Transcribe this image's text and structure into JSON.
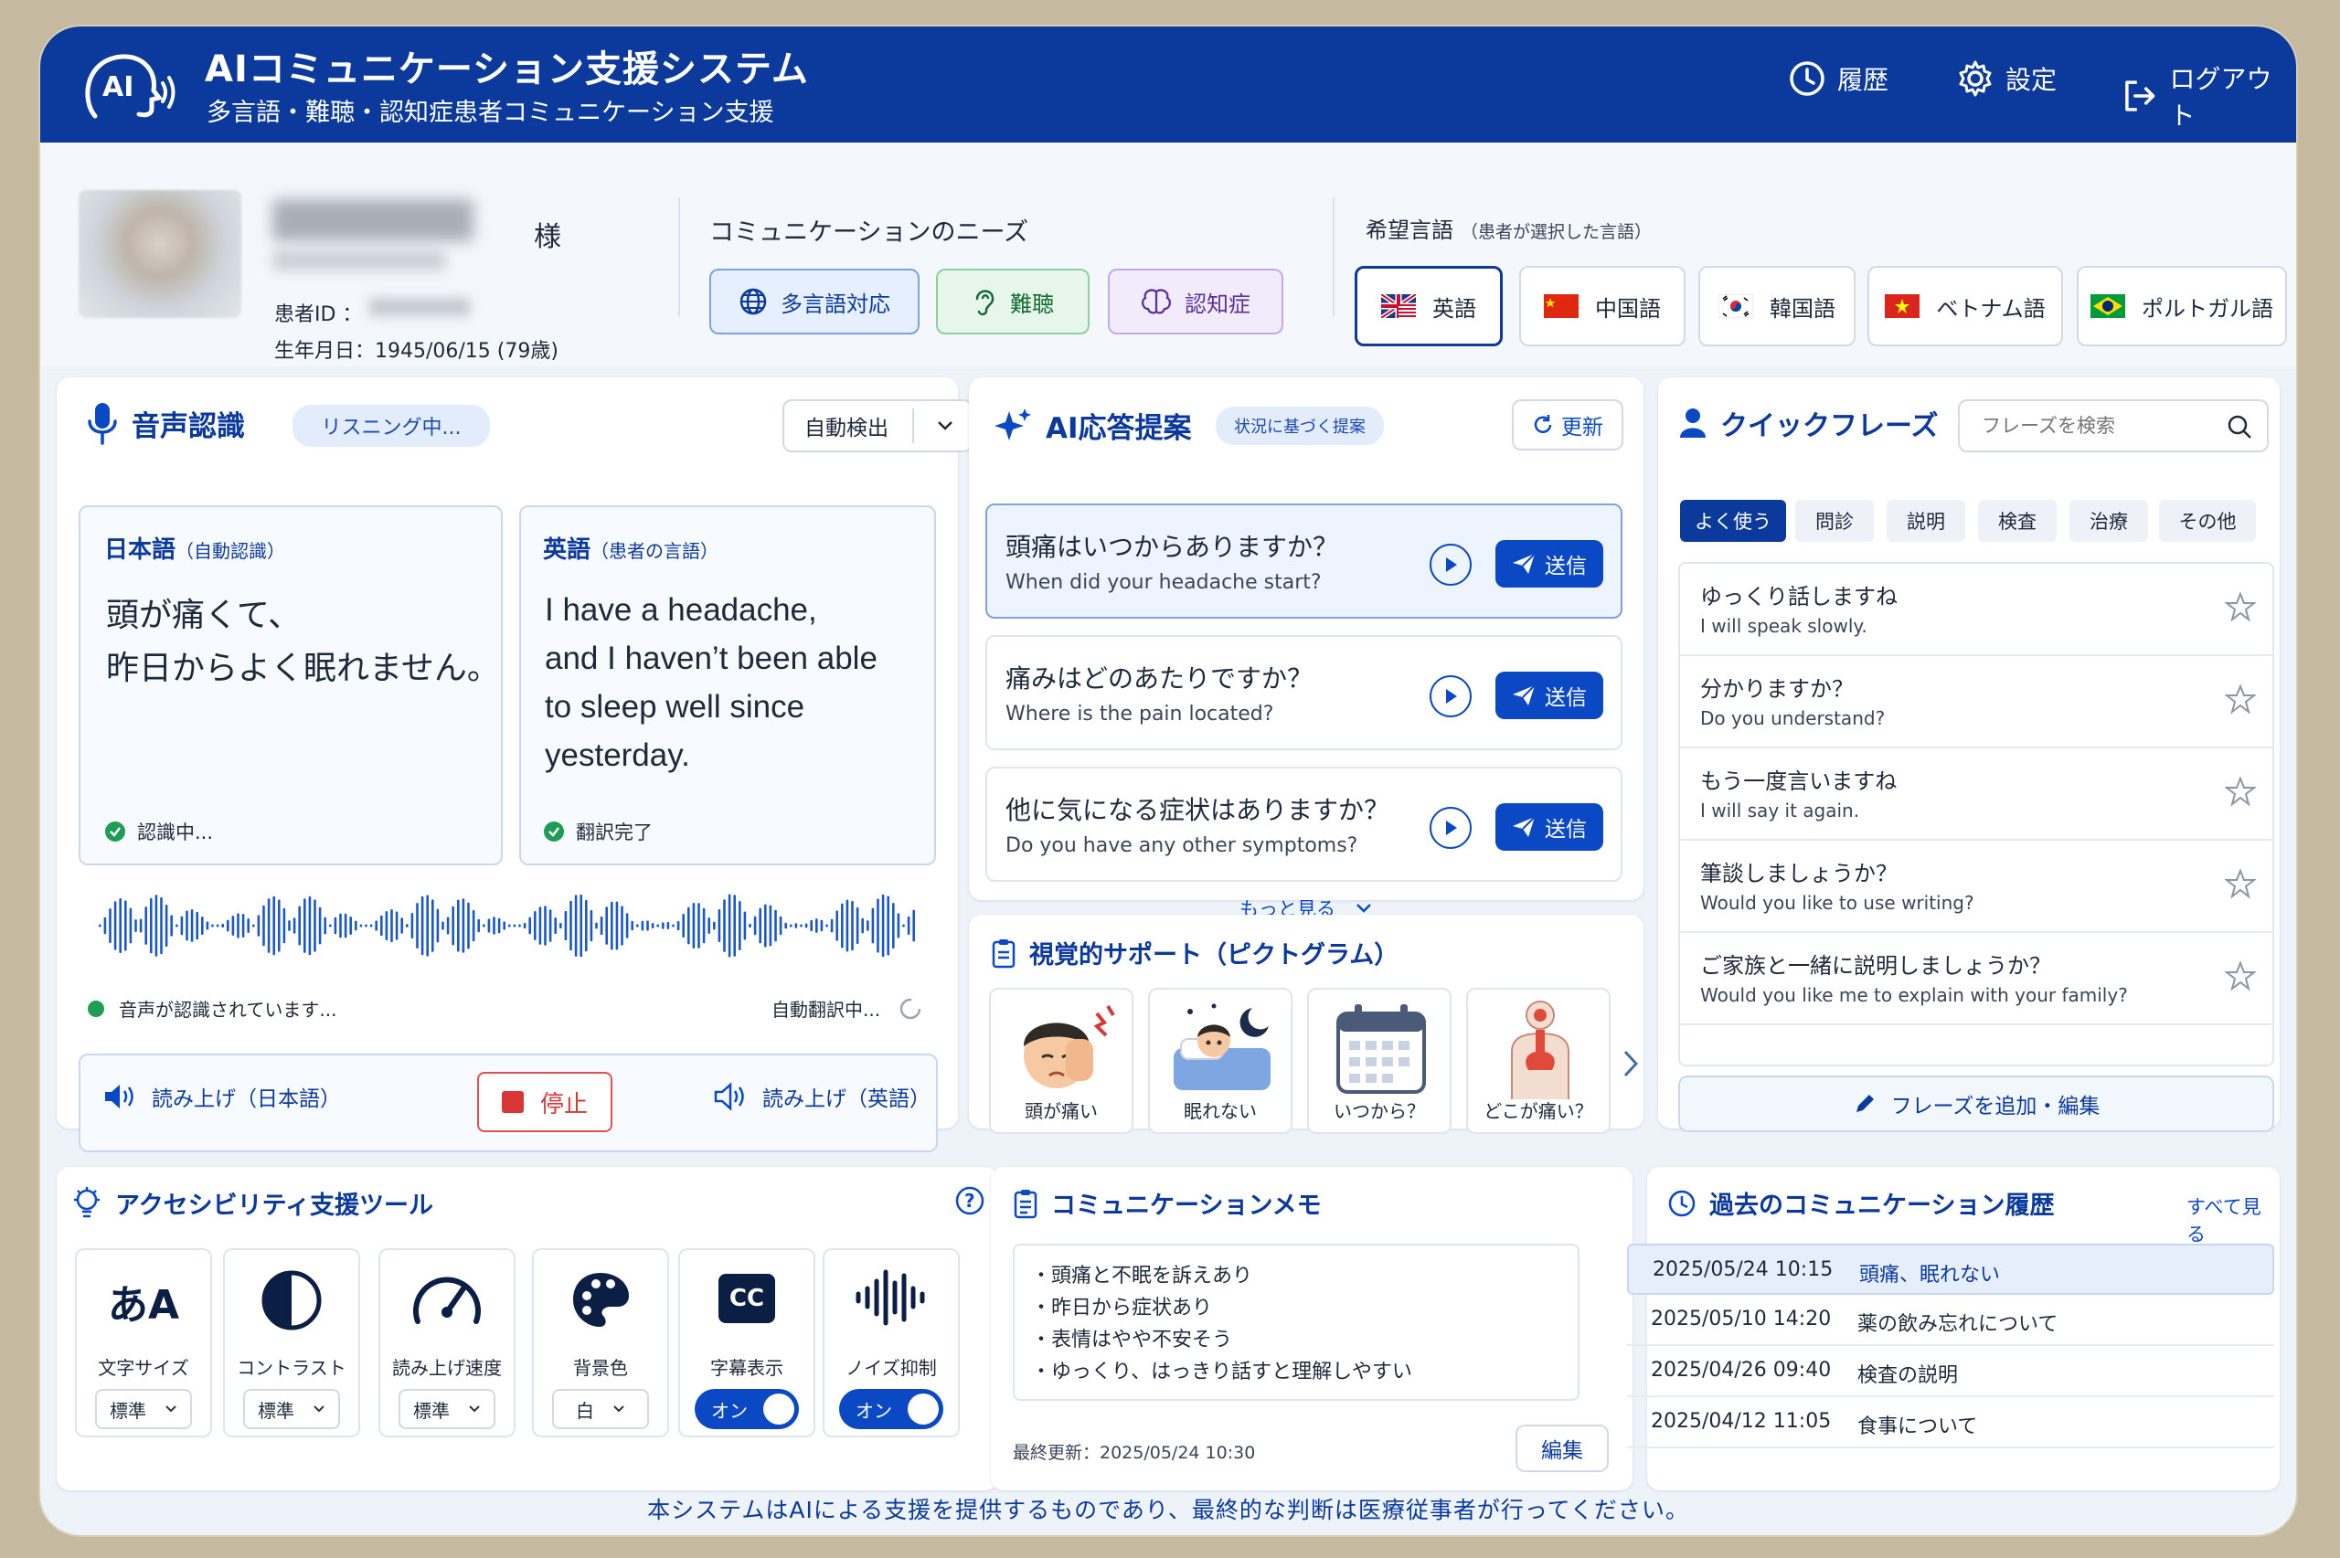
{
  "app": {
    "title": "AIコミュニケーション支援システム",
    "subtitle": "多言語・難聴・認知症患者コミュニケーション支援",
    "logo_text": "AI"
  },
  "nav": {
    "history": "履歴",
    "settings": "設定",
    "logout": "ログアウト"
  },
  "patient": {
    "honorific": "様",
    "id_label": "患者ID ：",
    "dob": "生年月日：1945/06/15 (79歳)"
  },
  "needs": {
    "title": "コミュニケーションのニーズ",
    "tags": [
      "多言語対応",
      "難聴",
      "認知症"
    ]
  },
  "language": {
    "title": "希望言語",
    "title_note": "（患者が選択した言語）",
    "options": [
      "英語",
      "中国語",
      "韓国語",
      "ベトナム語",
      "ポルトガル語"
    ],
    "selected": "英語"
  },
  "speech": {
    "title": "音声認識",
    "status_pill": "リスニング中...",
    "detect_select": "自動検出",
    "ja_label": "日本語",
    "ja_note": "（自動認識）",
    "ja_text_1": "頭が痛くて、",
    "ja_text_2": "昨日からよく眠れません。",
    "ja_status": "認識中...",
    "en_label": "英語",
    "en_note": "（患者の言語）",
    "en_text_1": "I have a headache,",
    "en_text_2": "and I haven’t been able",
    "en_text_3": "to sleep well since",
    "en_text_4": "yesterday.",
    "en_status": "翻訳完了",
    "recognizing": "音声が認識されています...",
    "auto_translating": "自動翻訳中...",
    "read_ja": "読み上げ（日本語）",
    "stop": "停止",
    "read_en": "読み上げ（英語）"
  },
  "ai": {
    "title": "AI応答提案",
    "pill": "状況に基づく提案",
    "refresh": "更新",
    "send": "送信",
    "more": "もっと見る",
    "suggestions": [
      {
        "ja": "頭痛はいつからありますか？",
        "en": "When did your headache start?"
      },
      {
        "ja": "痛みはどのあたりですか？",
        "en": "Where is the pain located?"
      },
      {
        "ja": "他に気になる症状はありますか？",
        "en": "Do you have any other symptoms?"
      }
    ]
  },
  "visual": {
    "title": "視覚的サポート（ピクトグラム）",
    "items": [
      "頭が痛い",
      "眠れない",
      "いつから？",
      "どこが痛い？"
    ]
  },
  "quick": {
    "title": "クイックフレーズ",
    "search_placeholder": "フレーズを検索",
    "tabs": [
      "よく使う",
      "問診",
      "説明",
      "検査",
      "治療",
      "その他"
    ],
    "active_tab": "よく使う",
    "phrases": [
      {
        "ja": "ゆっくり話しますね",
        "en": "I will speak slowly."
      },
      {
        "ja": "分かりますか？",
        "en": "Do you understand?"
      },
      {
        "ja": "もう一度言いますね",
        "en": "I will say it again."
      },
      {
        "ja": "筆談しましょうか？",
        "en": "Would you like to use writing?"
      },
      {
        "ja": "ご家族と一緒に説明しましょうか？",
        "en": "Would you like me to explain with your family?"
      }
    ],
    "add": "フレーズを追加・編集"
  },
  "a11y": {
    "title": "アクセシビリティ支援ツール",
    "tools": [
      {
        "icon": "font-size-icon",
        "icon_text": "あA",
        "label": "文字サイズ",
        "value": "標準",
        "kind": "select"
      },
      {
        "icon": "contrast-icon",
        "label": "コントラスト",
        "value": "標準",
        "kind": "select"
      },
      {
        "icon": "speedometer-icon",
        "label": "読み上げ速度",
        "value": "標準",
        "kind": "select"
      },
      {
        "icon": "palette-icon",
        "label": "背景色",
        "value": "白",
        "kind": "select"
      },
      {
        "icon": "closed-caption-icon",
        "icon_text": "CC",
        "label": "字幕表示",
        "value": "オン",
        "kind": "toggle"
      },
      {
        "icon": "waveform-icon",
        "label": "ノイズ抑制",
        "value": "オン",
        "kind": "toggle"
      }
    ]
  },
  "memo": {
    "title": "コミュニケーションメモ",
    "lines": [
      "・頭痛と不眠を訴えあり",
      "・昨日から症状あり",
      "・表情はやや不安そう",
      "・ゆっくり、はっきり話すと理解しやすい"
    ],
    "updated": "最終更新：2025/05/24 10:30",
    "edit": "編集"
  },
  "history": {
    "title": "過去のコミュニケーション履歴",
    "see_all": "すべて見る",
    "rows": [
      {
        "date": "2025/05/24 10:15",
        "topic": "頭痛、眠れない"
      },
      {
        "date": "2025/05/10 14:20",
        "topic": "薬の飲み忘れについて"
      },
      {
        "date": "2025/04/26 09:40",
        "topic": "検査の説明"
      },
      {
        "date": "2025/04/12 11:05",
        "topic": "食事について"
      }
    ]
  },
  "footer": "本システムはAIによる支援を提供するものであり、最終的な判断は医療従事者が行ってください。",
  "colors": {
    "primary": "#0b3a9c",
    "accent": "#0b49c4",
    "success": "#1f9d55",
    "danger": "#d93636"
  }
}
